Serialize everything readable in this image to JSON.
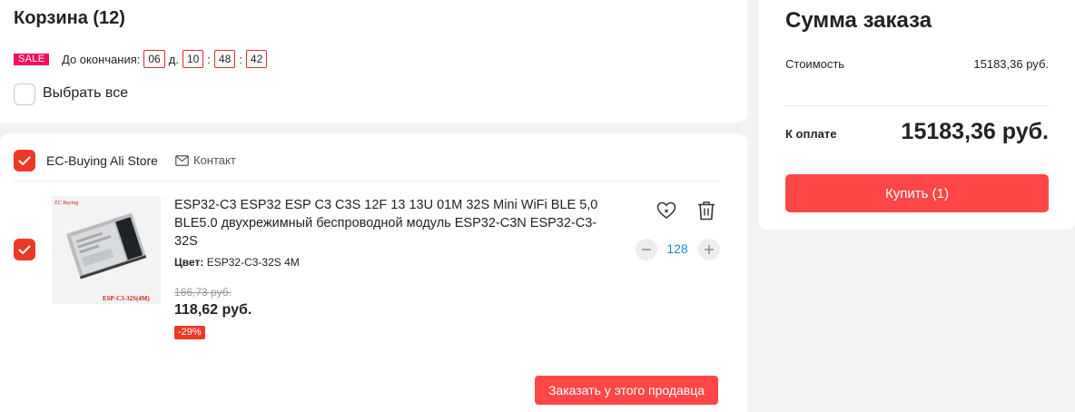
{
  "cart": {
    "title": "Корзина (12)",
    "sale_badge": "SALE",
    "timer": {
      "label": "До окончания:",
      "days": "06",
      "days_suffix": "д.",
      "hours": "10",
      "minutes": "48",
      "seconds": "42",
      "separator": ":"
    },
    "select_all_label": "Выбрать все",
    "select_all_checked": false
  },
  "store": {
    "name": "EC-Buying Ali Store",
    "contact_label": "Контакт",
    "checked": true,
    "item": {
      "checked": true,
      "title": "ESP32-C3 ESP32 ESP C3 C3S 12F 13 13U 01M 32S Mini WiFi BLE 5,0 BLE5.0 двухрежимный беспроводной модуль ESP32-C3N ESP32-C3-32S",
      "color_label": "Цвет:",
      "color_value": "ESP32-C3-32S 4M",
      "old_price": "166,73 руб.",
      "price": "118,62 руб.",
      "discount": "-29%",
      "quantity": "128",
      "image_brand_text": "EC Buying",
      "image_model_text": "ESP-C3-32S(4M)"
    },
    "order_button": "Заказать у этого продавца"
  },
  "summary": {
    "title": "Сумма заказа",
    "cost_label": "Стоимость",
    "cost_value": "15183,36 руб.",
    "pay_label": "К оплате",
    "pay_value": "15183,36 руб.",
    "buy_button": "Купить (1)"
  },
  "colors": {
    "accent_red": "#ff4747",
    "checkbox_red": "#ed3826",
    "sale_pink": "#ff0a5a",
    "quantity_blue": "#1f87c9"
  },
  "icons": [
    "check-icon",
    "mail-icon",
    "heart-icon",
    "trash-icon",
    "minus-icon",
    "plus-icon"
  ]
}
